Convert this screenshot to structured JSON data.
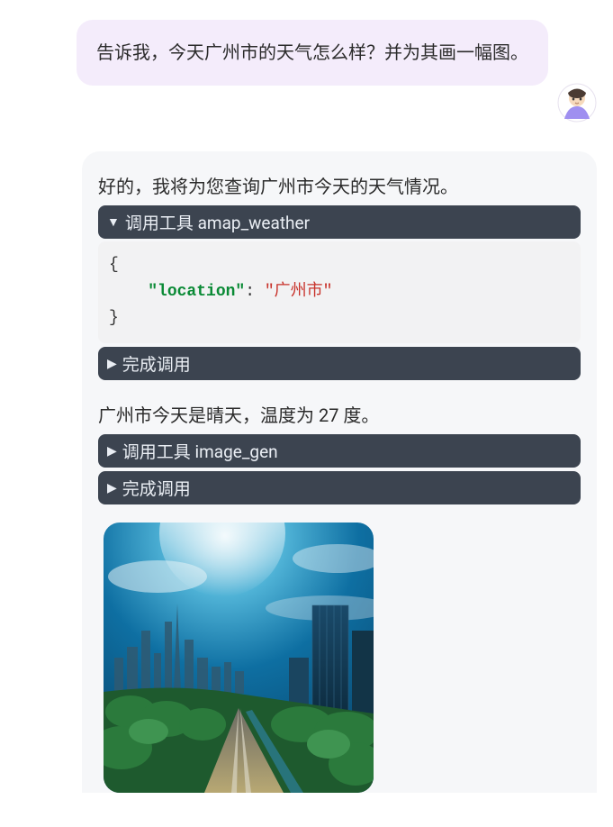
{
  "user": {
    "message": "告诉我，今天广州市的天气怎么样？并为其画一幅图。"
  },
  "assistant": {
    "line1": "好的，我将为您查询广州市今天的天气情况。",
    "tool1": {
      "header": "调用工具 amap_weather",
      "code_key": "\"location\"",
      "code_val": "\"广州市\""
    },
    "done_label": "完成调用",
    "line2": "广州市今天是晴天，温度为 27 度。",
    "tool2": {
      "header": "调用工具 image_gen"
    }
  },
  "icons": {
    "triangle_down": "▼",
    "triangle_right": "▶"
  }
}
